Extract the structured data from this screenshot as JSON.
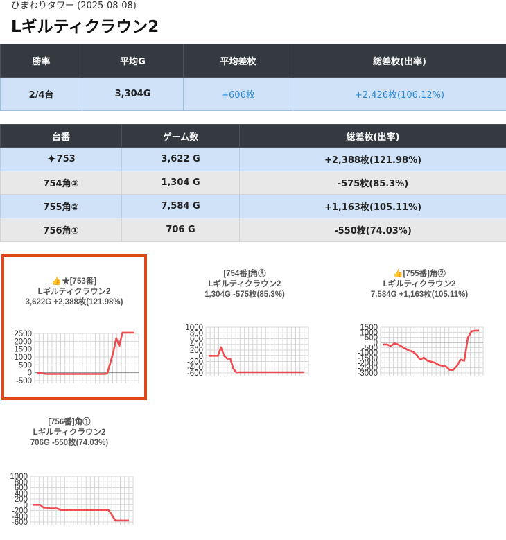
{
  "header": {
    "subtitle": "ひまわりタワー (2025-08-08)",
    "title": "Lギルティクラウン2"
  },
  "summary_table": {
    "columns": [
      "勝率",
      "平均G",
      "平均差枚",
      "総差枚(出率)"
    ],
    "row": [
      "2/4台",
      "3,304G",
      "+606枚",
      "+2,426枚(106.12%)"
    ]
  },
  "machine_table": {
    "columns": [
      "台番",
      "ゲーム数",
      "総差枚(出率)"
    ],
    "rows": [
      {
        "icon": "✦",
        "number": "753",
        "games": "3,622 G",
        "diff": "+2,388枚(121.98%)"
      },
      {
        "icon": "",
        "number": "754角③",
        "games": "1,304 G",
        "diff": "-575枚(85.3%)"
      },
      {
        "icon": "",
        "number": "755角②",
        "games": "7,584 G",
        "diff": "+1,163枚(105.11%)"
      },
      {
        "icon": "",
        "number": "756角①",
        "games": "706 G",
        "diff": "-550枚(74.03%)"
      }
    ]
  },
  "colors": {
    "header_bg": "#343a40",
    "row_blue": "#cfe2f7",
    "row_gray": "#e8e8e8",
    "accent_blue": "#2d8bd6",
    "line_red": "#f04b50",
    "selected_border": "#dc4a1a"
  },
  "chart_data": [
    {
      "type": "line",
      "title": "👍★[753番]",
      "subtitle": "Lギルティクラウン2",
      "caption": "3,622G +2,388枚(121.98%)",
      "ylim": [
        -500,
        2500
      ],
      "yticks": [
        2500,
        2000,
        1500,
        1000,
        500,
        0,
        -500
      ],
      "ytick_labels": [
        "2500",
        "2000",
        "1500",
        "1000",
        "500",
        "0",
        "-500"
      ],
      "grid": true,
      "values": [
        0,
        0,
        -40,
        -80,
        -80,
        -80,
        -80,
        -80,
        -80,
        -80,
        -80,
        -80,
        -80,
        -80,
        -80,
        -80,
        -80,
        -80,
        -80,
        -80,
        -80,
        -80,
        -80,
        -60,
        600,
        1300,
        2200,
        1700,
        2550,
        2550,
        2550,
        2550,
        2550
      ]
    },
    {
      "type": "line",
      "title": "[754番]角③",
      "subtitle": "Lギルティクラウン2",
      "caption": "1,304G -575枚(85.3%)",
      "ylim": [
        -600,
        1000
      ],
      "yticks": [
        1000,
        800,
        600,
        400,
        200,
        0,
        -200,
        -400,
        -600
      ],
      "ytick_labels": [
        "1000",
        "800",
        "600",
        "400",
        "200",
        "0",
        "-200",
        "-400",
        "-600"
      ],
      "grid": true,
      "values": [
        0,
        0,
        0,
        0,
        300,
        0,
        -100,
        -100,
        -450,
        -580,
        -575,
        -575,
        -575,
        -575,
        -575,
        -575,
        -575,
        -575,
        -575,
        -575,
        -575,
        -575,
        -575,
        -575,
        -575,
        -575,
        -575,
        -575,
        -575,
        -575,
        -575,
        -575
      ]
    },
    {
      "type": "line",
      "title": "👍[755番]角②",
      "subtitle": "Lギルティクラウン2",
      "caption": "7,584G +1,163枚(105.11%)",
      "ylim": [
        -3000,
        1500
      ],
      "yticks": [
        1500,
        1000,
        500,
        0,
        -500,
        -1000,
        -1500,
        -2000,
        -2500,
        -3000
      ],
      "ytick_labels": [
        "1500",
        "1000",
        "500",
        "0",
        "-500",
        "-1000",
        "-1500",
        "-2000",
        "-2500",
        "-3000"
      ],
      "grid": true,
      "values": [
        -200,
        -200,
        -350,
        -100,
        -200,
        -400,
        -600,
        -800,
        -900,
        -1200,
        -1700,
        -1500,
        -1800,
        -1900,
        -2000,
        -2200,
        -2300,
        -2350,
        -2700,
        -2700,
        -2300,
        -1700,
        -1800,
        500,
        1100,
        1163,
        1163
      ]
    },
    {
      "type": "line",
      "title": "[756番]角①",
      "subtitle": "Lギルティクラウン2",
      "caption": "706G -550枚(74.03%)",
      "ylim": [
        -600,
        1000
      ],
      "yticks": [
        1000,
        800,
        600,
        400,
        200,
        0,
        -200,
        -400,
        -600
      ],
      "ytick_labels": [
        "1000",
        "800",
        "600",
        "400",
        "200",
        "0",
        "-200",
        "-400",
        "-600"
      ],
      "grid": true,
      "values": [
        0,
        0,
        0,
        -100,
        -100,
        -130,
        -130,
        -130,
        -180,
        -180,
        -180,
        -180,
        -180,
        -180,
        -180,
        -180,
        -180,
        -180,
        -180,
        -180,
        -180,
        -180,
        -180,
        -350,
        -550,
        -550,
        -550,
        -550,
        -550
      ]
    }
  ]
}
